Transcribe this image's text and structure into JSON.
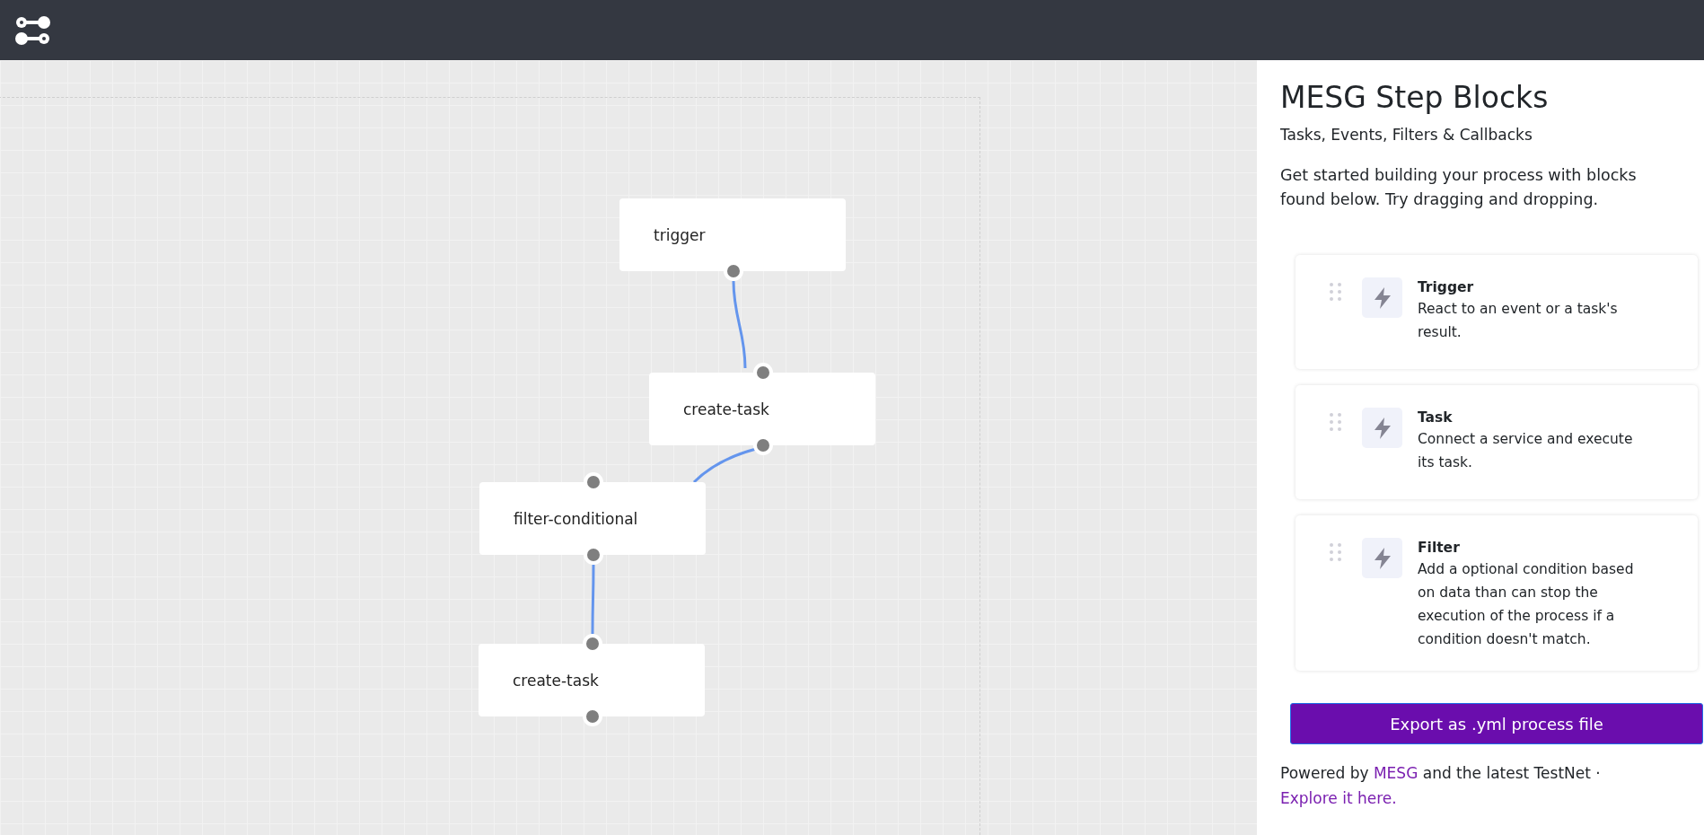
{
  "canvas": {
    "nodes": [
      {
        "label": "trigger",
        "kind": "trigger"
      },
      {
        "label": "create-task",
        "kind": "task"
      },
      {
        "label": "filter-conditional",
        "kind": "filter"
      },
      {
        "label": "create-task",
        "kind": "task"
      }
    ]
  },
  "sidebar": {
    "title": "MESG Step Blocks",
    "subtitle": "Tasks, Events, Filters & Callbacks",
    "intro": "Get started building your process with blocks found below. Try dragging and dropping.",
    "blocks": [
      {
        "title": "Trigger",
        "description": "React to an event or a task's result."
      },
      {
        "title": "Task",
        "description": "Connect a service and execute its task."
      },
      {
        "title": "Filter",
        "description": "Add a optional condition based on data than can stop the execution of the process if a condition doesn't match."
      }
    ],
    "export_button": "Export as .yml process file",
    "footer": {
      "text_1": "Powered by",
      "link_1": "MESG",
      "text_2": "and the latest TestNet ·",
      "link_2": "Explore it here."
    }
  }
}
